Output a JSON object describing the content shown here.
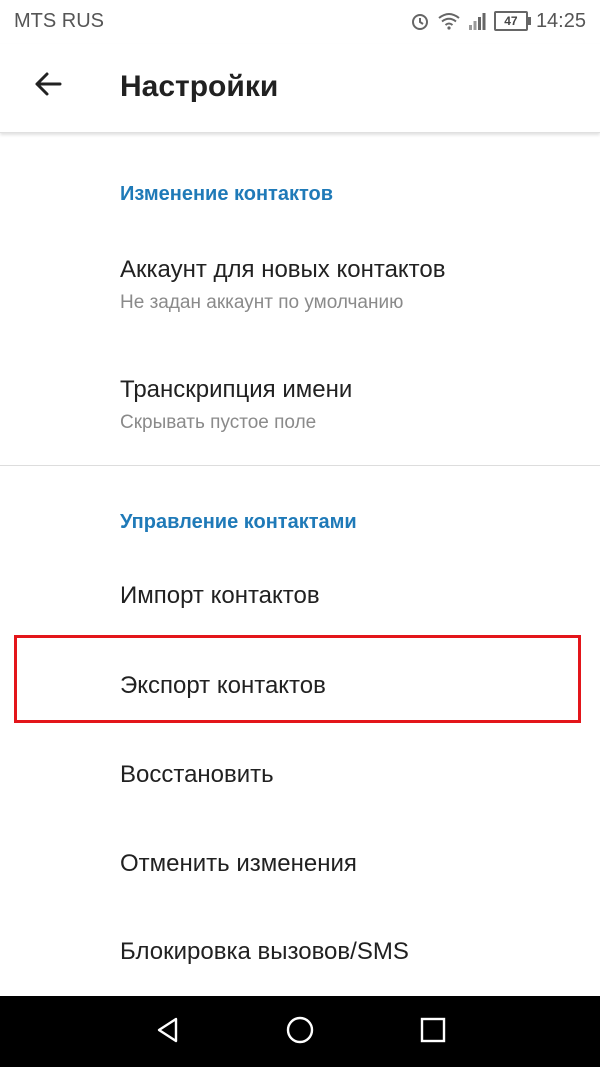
{
  "status_bar": {
    "carrier": "MTS RUS",
    "battery_level": "47",
    "time": "14:25",
    "icons": [
      "alarm-icon",
      "wifi-icon",
      "signal-icon",
      "battery-icon"
    ]
  },
  "app_bar": {
    "title": "Настройки",
    "back_icon": "arrow-back-icon"
  },
  "sections": [
    {
      "header": "Изменение контактов",
      "items": [
        {
          "title": "Аккаунт для новых контактов",
          "summary": "Не задан аккаунт по умолчанию"
        },
        {
          "title": "Транскрипция имени",
          "summary": "Скрывать пустое поле"
        }
      ]
    },
    {
      "header": "Управление контактами",
      "items": [
        {
          "title": "Импорт контактов"
        },
        {
          "title": "Экспорт контактов",
          "highlighted": true
        },
        {
          "title": "Восстановить"
        },
        {
          "title": "Отменить изменения"
        },
        {
          "title": "Блокировка вызовов/SMS"
        }
      ]
    }
  ],
  "colors": {
    "section_header": "#1f7ab8",
    "highlight_border": "#e3151a",
    "navbar_bg": "#000000"
  },
  "nav_bar": {
    "icons": [
      "back-triangle-icon",
      "home-circle-icon",
      "recents-square-icon"
    ]
  }
}
